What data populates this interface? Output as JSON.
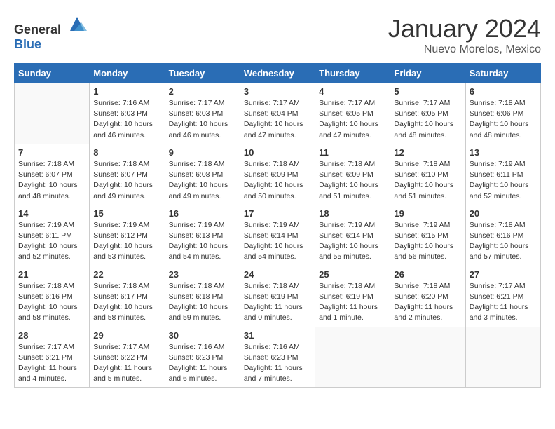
{
  "header": {
    "logo_general": "General",
    "logo_blue": "Blue",
    "month": "January 2024",
    "location": "Nuevo Morelos, Mexico"
  },
  "days_of_week": [
    "Sunday",
    "Monday",
    "Tuesday",
    "Wednesday",
    "Thursday",
    "Friday",
    "Saturday"
  ],
  "weeks": [
    [
      {
        "day": "",
        "sunrise": "",
        "sunset": "",
        "daylight": ""
      },
      {
        "day": "1",
        "sunrise": "Sunrise: 7:16 AM",
        "sunset": "Sunset: 6:03 PM",
        "daylight": "Daylight: 10 hours and 46 minutes."
      },
      {
        "day": "2",
        "sunrise": "Sunrise: 7:17 AM",
        "sunset": "Sunset: 6:03 PM",
        "daylight": "Daylight: 10 hours and 46 minutes."
      },
      {
        "day": "3",
        "sunrise": "Sunrise: 7:17 AM",
        "sunset": "Sunset: 6:04 PM",
        "daylight": "Daylight: 10 hours and 47 minutes."
      },
      {
        "day": "4",
        "sunrise": "Sunrise: 7:17 AM",
        "sunset": "Sunset: 6:05 PM",
        "daylight": "Daylight: 10 hours and 47 minutes."
      },
      {
        "day": "5",
        "sunrise": "Sunrise: 7:17 AM",
        "sunset": "Sunset: 6:05 PM",
        "daylight": "Daylight: 10 hours and 48 minutes."
      },
      {
        "day": "6",
        "sunrise": "Sunrise: 7:18 AM",
        "sunset": "Sunset: 6:06 PM",
        "daylight": "Daylight: 10 hours and 48 minutes."
      }
    ],
    [
      {
        "day": "7",
        "sunrise": "Sunrise: 7:18 AM",
        "sunset": "Sunset: 6:07 PM",
        "daylight": "Daylight: 10 hours and 48 minutes."
      },
      {
        "day": "8",
        "sunrise": "Sunrise: 7:18 AM",
        "sunset": "Sunset: 6:07 PM",
        "daylight": "Daylight: 10 hours and 49 minutes."
      },
      {
        "day": "9",
        "sunrise": "Sunrise: 7:18 AM",
        "sunset": "Sunset: 6:08 PM",
        "daylight": "Daylight: 10 hours and 49 minutes."
      },
      {
        "day": "10",
        "sunrise": "Sunrise: 7:18 AM",
        "sunset": "Sunset: 6:09 PM",
        "daylight": "Daylight: 10 hours and 50 minutes."
      },
      {
        "day": "11",
        "sunrise": "Sunrise: 7:18 AM",
        "sunset": "Sunset: 6:09 PM",
        "daylight": "Daylight: 10 hours and 51 minutes."
      },
      {
        "day": "12",
        "sunrise": "Sunrise: 7:18 AM",
        "sunset": "Sunset: 6:10 PM",
        "daylight": "Daylight: 10 hours and 51 minutes."
      },
      {
        "day": "13",
        "sunrise": "Sunrise: 7:19 AM",
        "sunset": "Sunset: 6:11 PM",
        "daylight": "Daylight: 10 hours and 52 minutes."
      }
    ],
    [
      {
        "day": "14",
        "sunrise": "Sunrise: 7:19 AM",
        "sunset": "Sunset: 6:11 PM",
        "daylight": "Daylight: 10 hours and 52 minutes."
      },
      {
        "day": "15",
        "sunrise": "Sunrise: 7:19 AM",
        "sunset": "Sunset: 6:12 PM",
        "daylight": "Daylight: 10 hours and 53 minutes."
      },
      {
        "day": "16",
        "sunrise": "Sunrise: 7:19 AM",
        "sunset": "Sunset: 6:13 PM",
        "daylight": "Daylight: 10 hours and 54 minutes."
      },
      {
        "day": "17",
        "sunrise": "Sunrise: 7:19 AM",
        "sunset": "Sunset: 6:14 PM",
        "daylight": "Daylight: 10 hours and 54 minutes."
      },
      {
        "day": "18",
        "sunrise": "Sunrise: 7:19 AM",
        "sunset": "Sunset: 6:14 PM",
        "daylight": "Daylight: 10 hours and 55 minutes."
      },
      {
        "day": "19",
        "sunrise": "Sunrise: 7:19 AM",
        "sunset": "Sunset: 6:15 PM",
        "daylight": "Daylight: 10 hours and 56 minutes."
      },
      {
        "day": "20",
        "sunrise": "Sunrise: 7:18 AM",
        "sunset": "Sunset: 6:16 PM",
        "daylight": "Daylight: 10 hours and 57 minutes."
      }
    ],
    [
      {
        "day": "21",
        "sunrise": "Sunrise: 7:18 AM",
        "sunset": "Sunset: 6:16 PM",
        "daylight": "Daylight: 10 hours and 58 minutes."
      },
      {
        "day": "22",
        "sunrise": "Sunrise: 7:18 AM",
        "sunset": "Sunset: 6:17 PM",
        "daylight": "Daylight: 10 hours and 58 minutes."
      },
      {
        "day": "23",
        "sunrise": "Sunrise: 7:18 AM",
        "sunset": "Sunset: 6:18 PM",
        "daylight": "Daylight: 10 hours and 59 minutes."
      },
      {
        "day": "24",
        "sunrise": "Sunrise: 7:18 AM",
        "sunset": "Sunset: 6:19 PM",
        "daylight": "Daylight: 11 hours and 0 minutes."
      },
      {
        "day": "25",
        "sunrise": "Sunrise: 7:18 AM",
        "sunset": "Sunset: 6:19 PM",
        "daylight": "Daylight: 11 hours and 1 minute."
      },
      {
        "day": "26",
        "sunrise": "Sunrise: 7:18 AM",
        "sunset": "Sunset: 6:20 PM",
        "daylight": "Daylight: 11 hours and 2 minutes."
      },
      {
        "day": "27",
        "sunrise": "Sunrise: 7:17 AM",
        "sunset": "Sunset: 6:21 PM",
        "daylight": "Daylight: 11 hours and 3 minutes."
      }
    ],
    [
      {
        "day": "28",
        "sunrise": "Sunrise: 7:17 AM",
        "sunset": "Sunset: 6:21 PM",
        "daylight": "Daylight: 11 hours and 4 minutes."
      },
      {
        "day": "29",
        "sunrise": "Sunrise: 7:17 AM",
        "sunset": "Sunset: 6:22 PM",
        "daylight": "Daylight: 11 hours and 5 minutes."
      },
      {
        "day": "30",
        "sunrise": "Sunrise: 7:16 AM",
        "sunset": "Sunset: 6:23 PM",
        "daylight": "Daylight: 11 hours and 6 minutes."
      },
      {
        "day": "31",
        "sunrise": "Sunrise: 7:16 AM",
        "sunset": "Sunset: 6:23 PM",
        "daylight": "Daylight: 11 hours and 7 minutes."
      },
      {
        "day": "",
        "sunrise": "",
        "sunset": "",
        "daylight": ""
      },
      {
        "day": "",
        "sunrise": "",
        "sunset": "",
        "daylight": ""
      },
      {
        "day": "",
        "sunrise": "",
        "sunset": "",
        "daylight": ""
      }
    ]
  ]
}
